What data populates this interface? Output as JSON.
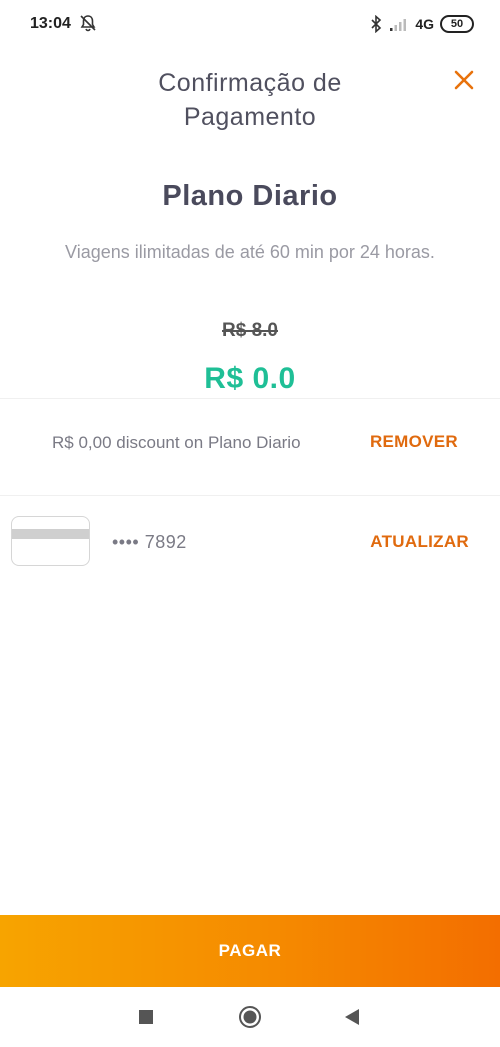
{
  "status_bar": {
    "time": "13:04",
    "network": "4G",
    "battery": "50",
    "icons": [
      "bell-muted-icon",
      "bluetooth-icon",
      "signal-icon",
      "battery-icon"
    ]
  },
  "header": {
    "title_line1": "Confirmação de",
    "title_line2": "Pagamento",
    "close_icon": "close-icon"
  },
  "plan": {
    "name": "Plano Diario",
    "description": "Viagens ilimitadas de até 60 min por 24 horas.",
    "old_price": "R$ 8.0",
    "new_price": "R$ 0.0"
  },
  "discount": {
    "text": "R$ 0,00 discount on Plano Diario",
    "remove_label": "REMOVER"
  },
  "payment_method": {
    "card_icon": "credit-card-icon",
    "masked_number": "•••• 7892",
    "update_label": "ATUALIZAR"
  },
  "pay_button": {
    "label": "PAGAR"
  },
  "nav_bar": {
    "icons": [
      "recents-icon",
      "home-icon",
      "back-icon"
    ]
  },
  "colors": {
    "accent_orange": "#e06a0e",
    "price_green": "#1fbf96",
    "button_gradient_start": "#f7a400",
    "button_gradient_end": "#f36e00"
  }
}
